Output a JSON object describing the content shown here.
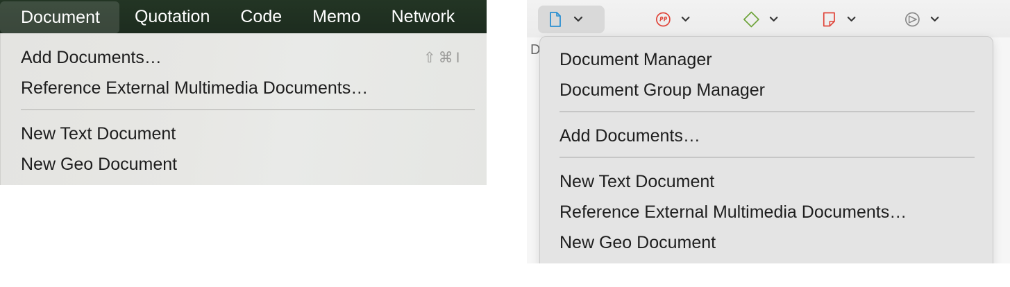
{
  "left": {
    "menubar": {
      "items": [
        {
          "label": "Document",
          "active": true
        },
        {
          "label": "Quotation",
          "active": false
        },
        {
          "label": "Code",
          "active": false
        },
        {
          "label": "Memo",
          "active": false
        },
        {
          "label": "Network",
          "active": false
        }
      ]
    },
    "menu": {
      "group1": [
        {
          "label": "Add Documents…",
          "shortcut": "⇧⌘I"
        },
        {
          "label": "Reference External Multimedia Documents…"
        }
      ],
      "group2": [
        {
          "label": "New Text Document"
        },
        {
          "label": "New Geo Document"
        }
      ]
    }
  },
  "right": {
    "toolbar": {
      "groups": [
        {
          "icon": "document-icon",
          "color": "#2a8fd1",
          "active": true
        },
        {
          "icon": "quotation-icon",
          "color": "#e0463b",
          "active": false
        },
        {
          "icon": "code-diamond-icon",
          "color": "#6ea43a",
          "active": false
        },
        {
          "icon": "memo-note-icon",
          "color": "#e0463b",
          "active": false
        },
        {
          "icon": "network-icon",
          "color": "#8a8a8a",
          "active": false
        }
      ]
    },
    "background_letter": "D",
    "menu": {
      "group1": [
        {
          "label": "Document Manager"
        },
        {
          "label": "Document Group Manager"
        }
      ],
      "group2": [
        {
          "label": "Add Documents…"
        }
      ],
      "group3": [
        {
          "label": "New Text Document"
        },
        {
          "label": "Reference External Multimedia Documents…"
        },
        {
          "label": "New Geo Document"
        }
      ]
    }
  }
}
